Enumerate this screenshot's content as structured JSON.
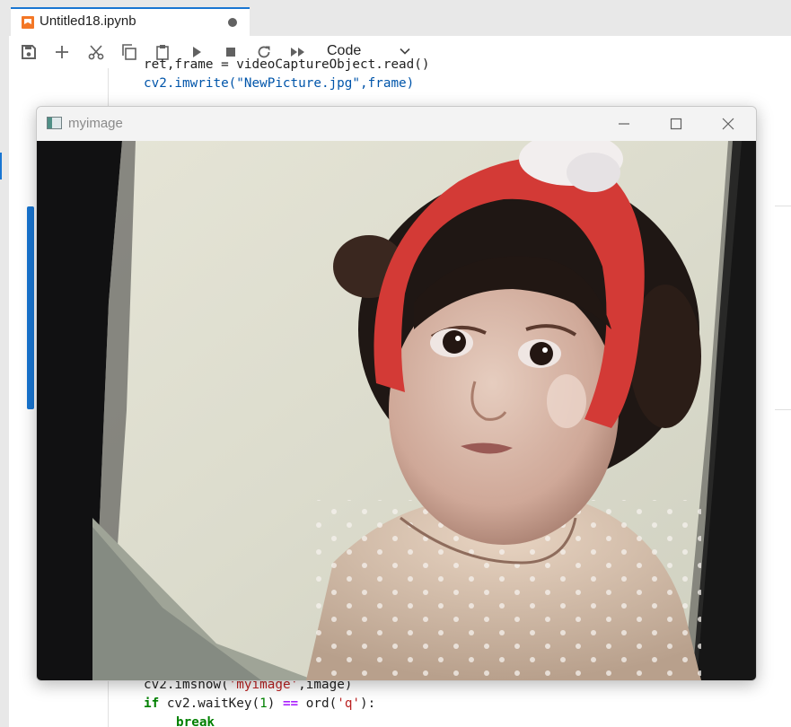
{
  "tab": {
    "title": "Untitled18.ipynb"
  },
  "toolbar": {
    "cell_type": "Code"
  },
  "code_top": {
    "line1": "ret,frame = videoCaptureObject.read()",
    "line2": "cv2.imwrite(\"NewPicture.jpg\",frame)"
  },
  "code_bottom": {
    "line1_fn": "cv2.imshow(",
    "line1_str": "'myimage'",
    "line1_rest": ",image)",
    "line2_kw": "if",
    "line2_a": " cv2.waitKey(",
    "line2_num": "1",
    "line2_b": ") ",
    "line2_op": "==",
    "line2_c": " ord(",
    "line2_str": "'q'",
    "line2_d": "):",
    "line3_kw": "break"
  },
  "window": {
    "title": "myimage"
  },
  "icons": [
    "notebook-icon",
    "save-icon",
    "add-icon",
    "cut-icon",
    "copy-icon",
    "paste-icon",
    "run-icon",
    "stop-icon",
    "restart-icon",
    "run-all-icon",
    "chevron-down-icon",
    "window-app-icon",
    "minimize-icon",
    "maximize-icon",
    "close-icon"
  ]
}
